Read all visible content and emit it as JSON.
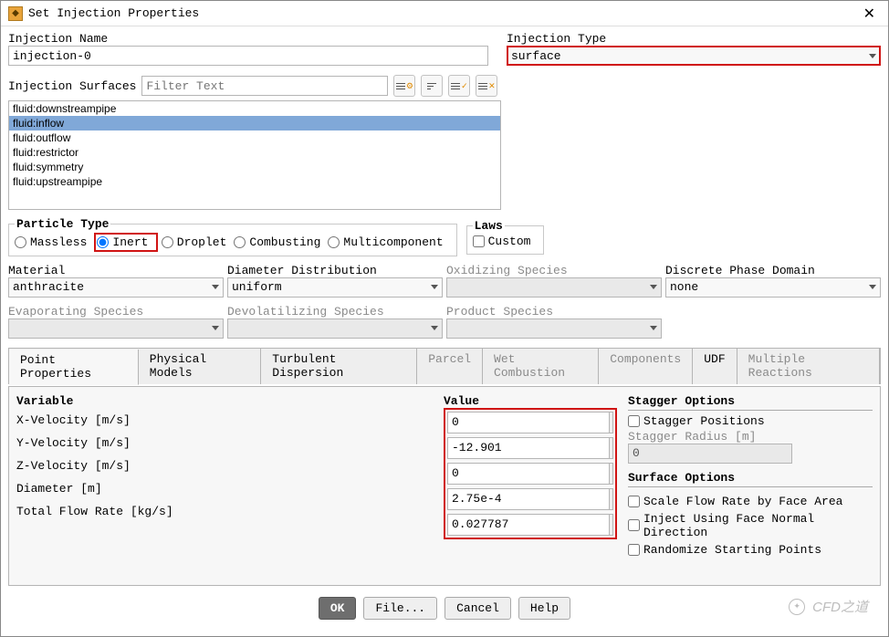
{
  "window": {
    "title": "Set Injection Properties"
  },
  "injection_name": {
    "label": "Injection Name",
    "value": "injection-0"
  },
  "injection_type": {
    "label": "Injection Type",
    "value": "surface"
  },
  "injection_surfaces": {
    "label": "Injection Surfaces",
    "filter_placeholder": "Filter Text",
    "items": [
      {
        "text": "fluid:downstreampipe",
        "selected": false
      },
      {
        "text": "fluid:inflow",
        "selected": true
      },
      {
        "text": "fluid:outflow",
        "selected": false
      },
      {
        "text": "fluid:restrictor",
        "selected": false
      },
      {
        "text": "fluid:symmetry",
        "selected": false
      },
      {
        "text": "fluid:upstreampipe",
        "selected": false
      }
    ]
  },
  "particle_type": {
    "legend": "Particle Type",
    "options": [
      {
        "label": "Massless",
        "checked": false
      },
      {
        "label": "Inert",
        "checked": true,
        "highlight": true
      },
      {
        "label": "Droplet",
        "checked": false
      },
      {
        "label": "Combusting",
        "checked": false
      },
      {
        "label": "Multicomponent",
        "checked": false
      }
    ]
  },
  "laws": {
    "legend": "Laws",
    "custom_label": "Custom",
    "custom_checked": false
  },
  "material": {
    "label": "Material",
    "value": "anthracite"
  },
  "diameter_distribution": {
    "label": "Diameter Distribution",
    "value": "uniform"
  },
  "oxidizing_species": {
    "label": "Oxidizing Species",
    "value": ""
  },
  "discrete_phase_domain": {
    "label": "Discrete Phase Domain",
    "value": "none"
  },
  "evaporating_species": {
    "label": "Evaporating Species",
    "value": ""
  },
  "devolatilizing_species": {
    "label": "Devolatilizing Species",
    "value": ""
  },
  "product_species": {
    "label": "Product Species",
    "value": ""
  },
  "tabs": [
    {
      "label": "Point Properties",
      "state": "active"
    },
    {
      "label": "Physical Models",
      "state": "enabled"
    },
    {
      "label": "Turbulent Dispersion",
      "state": "enabled"
    },
    {
      "label": "Parcel",
      "state": "disabled"
    },
    {
      "label": "Wet Combustion",
      "state": "disabled"
    },
    {
      "label": "Components",
      "state": "disabled"
    },
    {
      "label": "UDF",
      "state": "enabled"
    },
    {
      "label": "Multiple Reactions",
      "state": "disabled"
    }
  ],
  "point_properties": {
    "variable_header": "Variable",
    "value_header": "Value",
    "rows": [
      {
        "label": "X-Velocity [m/s]",
        "value": "0"
      },
      {
        "label": "Y-Velocity [m/s]",
        "value": "-12.901"
      },
      {
        "label": "Z-Velocity [m/s]",
        "value": "0"
      },
      {
        "label": "Diameter [m]",
        "value": "2.75e-4"
      },
      {
        "label": "Total Flow Rate [kg/s]",
        "value": "0.027787"
      }
    ]
  },
  "stagger_options": {
    "title": "Stagger Options",
    "positions_label": "Stagger Positions",
    "positions_checked": false,
    "radius_label": "Stagger Radius [m]",
    "radius_value": "0"
  },
  "surface_options": {
    "title": "Surface Options",
    "items": [
      {
        "label": "Scale Flow Rate by Face Area",
        "checked": false
      },
      {
        "label": "Inject Using Face Normal Direction",
        "checked": false
      },
      {
        "label": "Randomize Starting Points",
        "checked": false
      }
    ]
  },
  "buttons": {
    "ok": "OK",
    "file": "File...",
    "cancel": "Cancel",
    "help": "Help"
  },
  "watermark": "CFD之道"
}
